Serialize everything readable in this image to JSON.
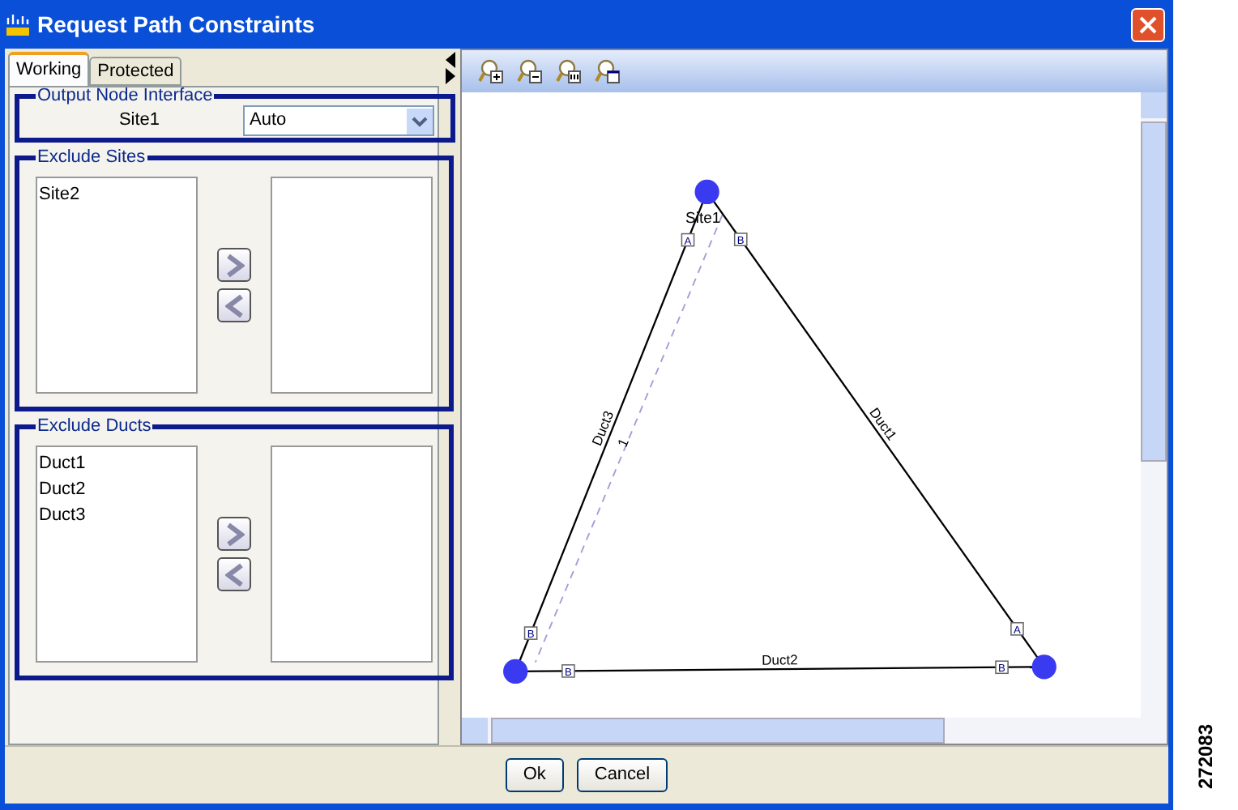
{
  "window": {
    "title": "Request Path Constraints"
  },
  "tabs": [
    {
      "label": "Working",
      "selected": true
    },
    {
      "label": "Protected",
      "selected": false
    }
  ],
  "output_node_interface": {
    "title": "Output Node Interface",
    "site": "Site1",
    "value": "Auto"
  },
  "exclude_sites": {
    "title": "Exclude Sites",
    "available": [
      "Site2"
    ]
  },
  "exclude_ducts": {
    "title": "Exclude Ducts",
    "available": [
      "Duct1",
      "Duct2",
      "Duct3"
    ]
  },
  "diagram": {
    "nodes": [
      {
        "label": "Site1"
      }
    ],
    "edges": [
      {
        "label": "Duct3",
        "end_a": "A",
        "end_b": "B"
      },
      {
        "label": "Duct1",
        "end_a": "B",
        "end_b": "A"
      },
      {
        "label": "Duct2",
        "end_a": "B",
        "end_b": "B"
      }
    ],
    "path": {
      "label": "1"
    }
  },
  "buttons": [
    "Ok",
    "Cancel"
  ],
  "figure_id": "272083"
}
